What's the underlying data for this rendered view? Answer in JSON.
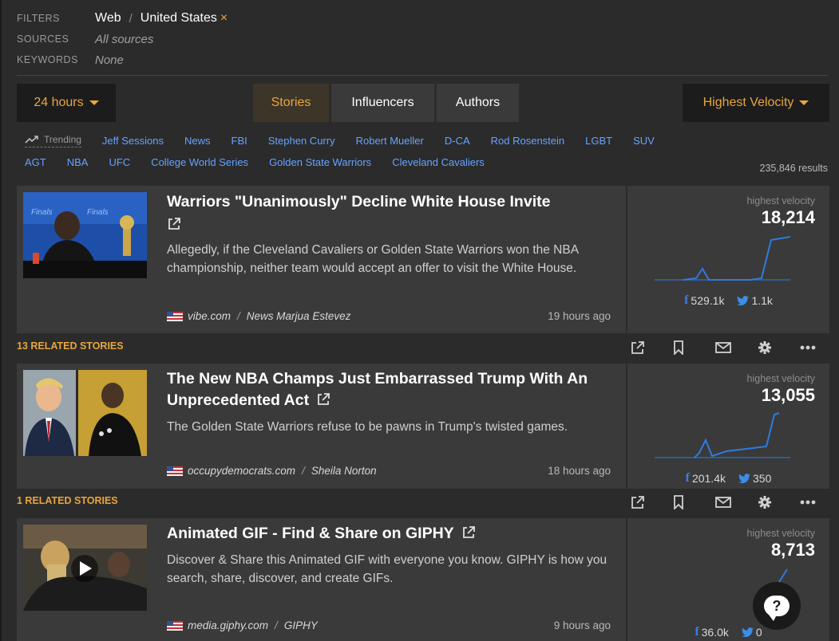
{
  "filters": {
    "filters_label": "FILTERS",
    "sources_label": "SOURCES",
    "keywords_label": "KEYWORDS",
    "filter_web": "Web",
    "filter_sep": "/",
    "filter_country": "United States",
    "filter_remove": "×",
    "sources_value": "All sources",
    "keywords_value": "None"
  },
  "toolbar": {
    "time_range": "24 hours",
    "sort": "Highest Velocity",
    "tabs": [
      {
        "label": "Stories",
        "active": true
      },
      {
        "label": "Influencers",
        "active": false
      },
      {
        "label": "Authors",
        "active": false
      }
    ]
  },
  "trending": {
    "label": "Trending",
    "row1": [
      "Jeff Sessions",
      "News",
      "FBI",
      "Stephen Curry",
      "Robert Mueller",
      "D-CA",
      "Rod Rosenstein",
      "LGBT",
      "SUV"
    ],
    "row2": [
      "AGT",
      "NBA",
      "UFC",
      "College World Series",
      "Golden State Warriors",
      "Cleveland Cavaliers"
    ],
    "results": "235,846 results"
  },
  "stories": [
    {
      "title": "Warriors \"Unanimously\" Decline White House Invite",
      "description": "Allegedly, if the Cleveland Cavaliers or Golden State Warriors won the NBA championship, neither team would accept an offer to visit the White House.",
      "source": "vibe.com",
      "author": "News Marjua Estevez",
      "age": "19 hours ago",
      "velocity_label": "highest velocity",
      "velocity": "18,214",
      "facebook": "529.1k",
      "twitter": "1.1k",
      "related": "13 RELATED STORIES"
    },
    {
      "title": "The New NBA Champs Just Embarrassed Trump With An Unprecedented Act",
      "description": "The Golden State Warriors refuse to be pawns in Trump's twisted games.",
      "source": "occupydemocrats.com",
      "author": "Sheila Norton",
      "age": "18 hours ago",
      "velocity_label": "highest velocity",
      "velocity": "13,055",
      "facebook": "201.4k",
      "twitter": "350",
      "related": "1 RELATED STORIES"
    },
    {
      "title": "Animated GIF - Find & Share on GIPHY",
      "description": "Discover & Share this Animated GIF with everyone you know. GIPHY is how you search, share, discover, and create GIFs.",
      "source": "media.giphy.com",
      "author": "GIPHY",
      "age": "9 hours ago",
      "velocity_label": "highest velocity",
      "velocity": "8,713",
      "facebook": "36.0k",
      "twitter": "0"
    }
  ],
  "colors": {
    "accent": "#e9a53d",
    "link": "#66a3ff",
    "background": "#2b2b2b",
    "card": "#3a3a3a",
    "spark": "#2f7be0"
  },
  "icons": [
    "trending-icon",
    "external-link-icon",
    "flag-us-icon",
    "facebook-icon",
    "twitter-icon",
    "share-icon",
    "bookmark-icon",
    "mail-icon",
    "gear-icon",
    "more-icon",
    "play-icon",
    "chat-help-icon"
  ]
}
